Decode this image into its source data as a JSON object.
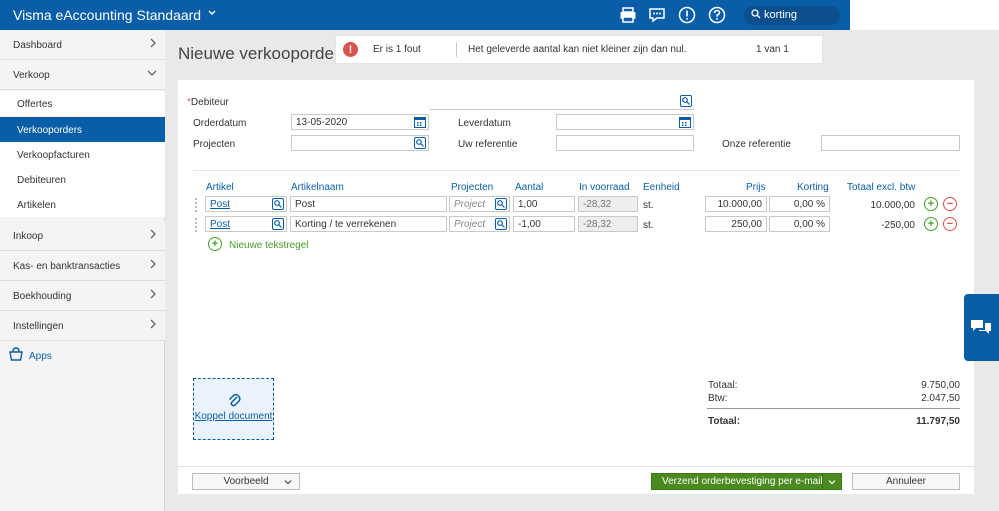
{
  "app": {
    "title": "Visma eAccounting Standaard"
  },
  "header": {
    "icons": [
      "print-icon",
      "chat-icon",
      "alert-icon",
      "help-icon"
    ],
    "search_value": "korting"
  },
  "sidebar": {
    "items": [
      {
        "label": "Dashboard"
      },
      {
        "label": "Verkoop"
      },
      {
        "label": "Inkoop"
      },
      {
        "label": "Kas- en banktransacties"
      },
      {
        "label": "Boekhouding"
      },
      {
        "label": "Instellingen"
      }
    ],
    "sub_items": [
      {
        "label": "Offertes"
      },
      {
        "label": "Verkooporders"
      },
      {
        "label": "Verkoopfacturen"
      },
      {
        "label": "Debiteuren"
      },
      {
        "label": "Artikelen"
      }
    ],
    "apps_label": "Apps"
  },
  "page": {
    "title": "Nieuwe verkooporder"
  },
  "error": {
    "count_text": "Er is 1 fout",
    "message": "Het geleverde aantal kan niet kleiner zijn dan nul.",
    "pager": "1 van 1"
  },
  "form": {
    "debiteur_label": "Debiteur",
    "orderdatum_label": "Orderdatum",
    "orderdatum_value": "13-05-2020",
    "projecten_label": "Projecten",
    "leverdatum_label": "Leverdatum",
    "uw_referentie_label": "Uw referentie",
    "onze_referentie_label": "Onze referentie"
  },
  "table": {
    "headers": {
      "artikel": "Artikel",
      "artikelnaam": "Artikelnaam",
      "projecten": "Projecten",
      "aantal": "Aantal",
      "in_voorraad": "In voorraad",
      "eenheid": "Eenheid",
      "prijs": "Prijs",
      "korting": "Korting",
      "totaal": "Totaal excl. btw"
    },
    "rows": [
      {
        "artikel": "Post",
        "artikelnaam": "Post",
        "project_placeholder": "Project",
        "aantal": "1,00",
        "voorraad": "-28,32",
        "eenheid": "st.",
        "prijs": "10.000,00",
        "korting": "0,00 %",
        "totaal": "10.000,00"
      },
      {
        "artikel": "Post",
        "artikelnaam": "Korting / te verrekenen",
        "project_placeholder": "Project",
        "aantal": "-1,00",
        "voorraad": "-28,32",
        "eenheid": "st.",
        "prijs": "250,00",
        "korting": "0,00 %",
        "totaal": "-250,00"
      }
    ],
    "add_line_label": "Nieuwe tekstregel"
  },
  "attach": {
    "label": "Koppel document"
  },
  "totals": {
    "totaal_label": "Totaal:",
    "totaal_value": "9.750,00",
    "btw_label": "Btw:",
    "btw_value": "2.047,50",
    "grand_label": "Totaal:",
    "grand_value": "11.797,50"
  },
  "footer": {
    "preview_label": "Voorbeeld",
    "send_label": "Verzend orderbevestiging per e-mail",
    "cancel_label": "Annuleer"
  },
  "colors": {
    "brand": "#0a5ea8",
    "primary_button": "#4a8a1e",
    "error": "#d9534f",
    "add": "#4a9e2a"
  }
}
